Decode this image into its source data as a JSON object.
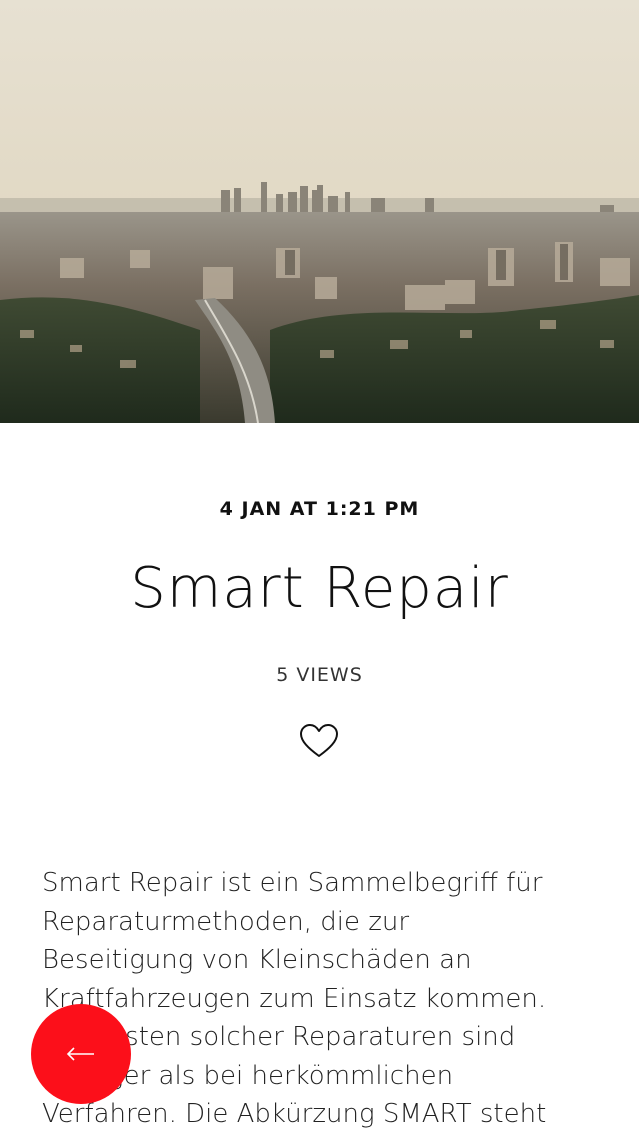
{
  "post": {
    "date": "4 JAN AT 1:21 PM",
    "title": "Smart Repair",
    "views": "5 VIEWS",
    "body_lines": [
      "Smart Repair ist ein Sammelbegriff für",
      "Reparaturmethoden, die zur",
      "Beseitigung von Kleinschäden an",
      "Kraftfahrzeugen zum Einsatz kommen.",
      "Die Kosten solcher Reparaturen sind",
      "geringer als bei herkömmlichen",
      "Verfahren. Die Abkürzung SMART steht"
    ]
  },
  "hero": {
    "image_icon": "city-skyline-photo"
  },
  "icons": {
    "like": "heart-outline-icon",
    "back": "arrow-left-icon"
  },
  "colors": {
    "fab_background": "#fc0f1a",
    "text": "#111111",
    "background": "#ffffff"
  }
}
